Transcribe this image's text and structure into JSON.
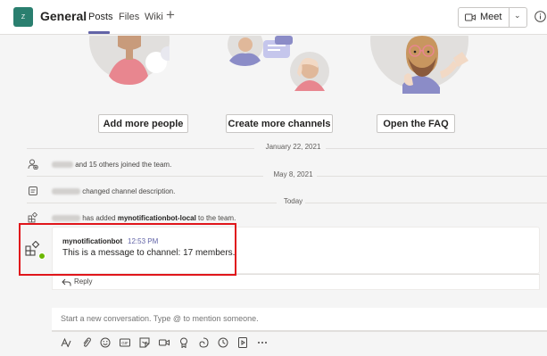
{
  "header": {
    "team_initial": "Z",
    "channel_name": "General",
    "tabs": [
      {
        "label": "Posts",
        "active": true
      },
      {
        "label": "Files",
        "active": false
      },
      {
        "label": "Wiki",
        "active": false
      }
    ],
    "add_tab_label": "+",
    "meet_label": "Meet"
  },
  "welcome": {
    "buttons": [
      {
        "label": "Add more people"
      },
      {
        "label": "Create more channels"
      },
      {
        "label": "Open the FAQ"
      }
    ]
  },
  "timeline": [
    {
      "type": "date",
      "label": "January 22, 2021"
    },
    {
      "type": "system",
      "icon": "people-added-icon",
      "text": "and 15 others joined the team."
    },
    {
      "type": "date",
      "label": "May 8, 2021"
    },
    {
      "type": "system",
      "icon": "description-icon",
      "text": "changed channel description."
    },
    {
      "type": "date",
      "label": "Today"
    },
    {
      "type": "system",
      "icon": "app-icon",
      "text_prefix": "has added ",
      "text_bold": "mynotificationbot-local",
      "text_suffix": " to the team."
    }
  ],
  "message": {
    "sender": "mynotificationbot",
    "time": "12:53 PM",
    "text": "This is a message to channel: 17 members.",
    "reply_label": "Reply"
  },
  "compose": {
    "placeholder": "Start a new conversation. Type @ to mention someone."
  },
  "toolbar_icons": [
    "format-icon",
    "attach-icon",
    "emoji-icon",
    "gif-icon",
    "sticker-icon",
    "meet-now-icon",
    "praise-icon",
    "loop-icon",
    "schedule-icon",
    "stream-icon",
    "more-icon"
  ],
  "colors": {
    "accent": "#6264a7",
    "team_avatar": "#2a7f6f",
    "highlight": "#e0161b",
    "presence": "#6bb700"
  }
}
